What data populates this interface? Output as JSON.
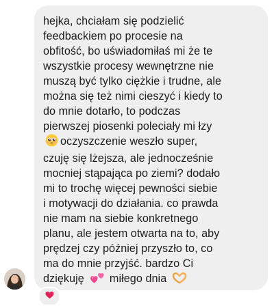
{
  "message": {
    "lines": [
      "hejka, chciałam się podzielić",
      "feedbackiem po procesie na",
      "obfitość, bo uświadomiłaś mi że te",
      "wszystkie procesy wewnętrzne nie",
      "muszą być tylko ciężkie i trudne, ale",
      "można się też nimi cieszyć i kiedy to",
      "do mnie dotarło, to podczas",
      "pierwszej piosenki poleciały mi łzy",
      "oczyszczenie weszło super,",
      "czuję się lżejsza, ale jednocześnie",
      "mocniej stąpająca po ziemi? dodało",
      "mi to trochę więcej pewności siebie",
      "i motywacji do działania. co prawda",
      "nie mam na siebie konkretnego",
      "planu, ale jestem otwarta na to, aby",
      "prędzej czy później przyszło to, co",
      "ma do mnie przyjść. bardzo Ci",
      "dziękuję",
      "miłego dnia"
    ],
    "icons": {
      "tear_emoji": "pleading-face-icon",
      "hearts_emoji": "two-hearts-icon",
      "hands_emoji": "heart-hands-icon"
    }
  },
  "reaction": {
    "icon": "red-heart-icon",
    "color": "#e0245e"
  },
  "colors": {
    "bubble": "#efeff0",
    "text": "#1c1c1e"
  }
}
